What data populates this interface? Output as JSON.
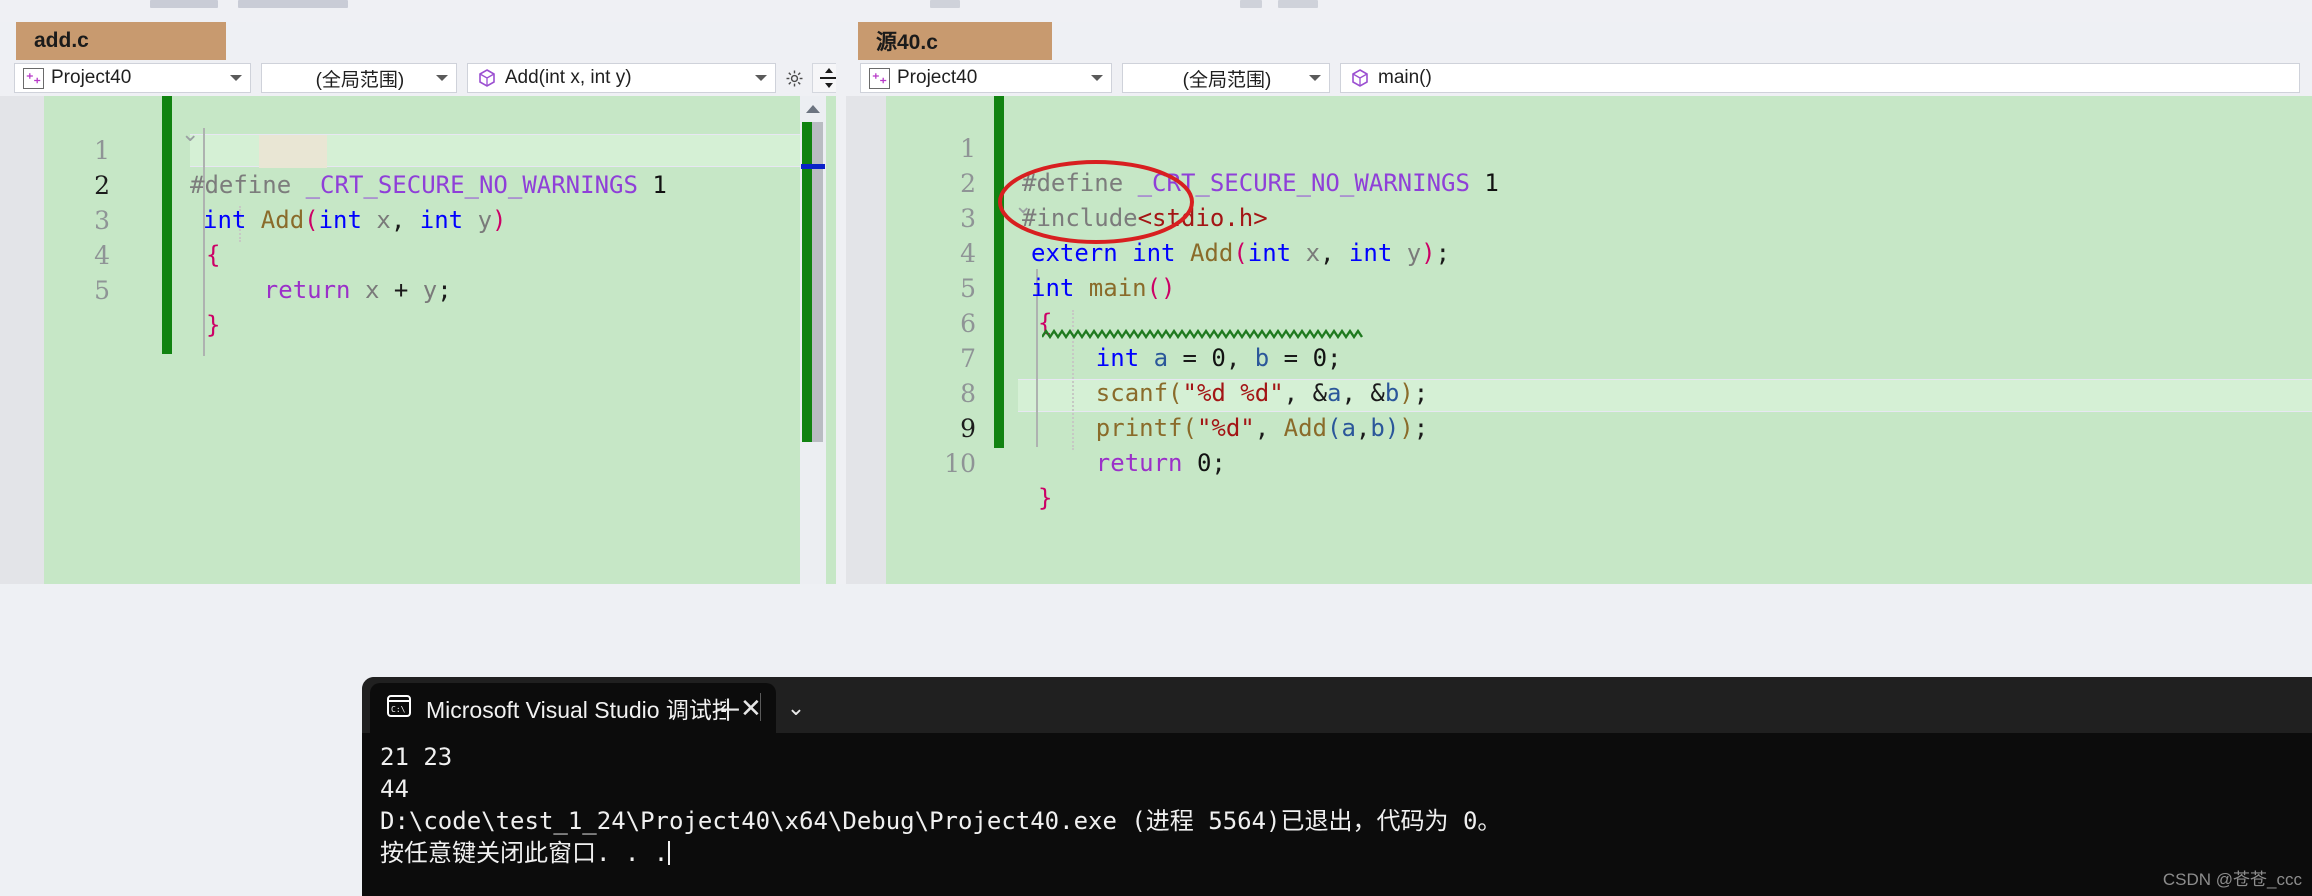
{
  "app": {
    "watermark": "CSDN @苍苍_ccc"
  },
  "tabs": [
    {
      "label": "add.c",
      "name": "tab-add-c"
    },
    {
      "label": "源40.c",
      "name": "tab-source40-c"
    }
  ],
  "left_pane": {
    "navbar": {
      "project": "Project40",
      "scope": "(全局范围)",
      "member": "Add(int x, int y)",
      "project_icon": "project-icon",
      "member_icon": "method-cube-icon",
      "gear_icon": "gear-icon",
      "caret_icon": "chevron-down-icon",
      "split_icon": "split-editor-icon"
    },
    "lines": [
      {
        "n": "1",
        "text": "#define _CRT_SECURE_NO_WARNINGS 1"
      },
      {
        "n": "2",
        "text": "int Add(int x, int y)"
      },
      {
        "n": "3",
        "text": "{"
      },
      {
        "n": "4",
        "text": "    return x + y;"
      },
      {
        "n": "5",
        "text": "}"
      }
    ]
  },
  "right_pane": {
    "navbar": {
      "project": "Project40",
      "scope": "(全局范围)",
      "member": "main()",
      "project_icon": "project-icon",
      "member_icon": "method-cube-icon"
    },
    "lines": [
      {
        "n": "1",
        "text": "#define _CRT_SECURE_NO_WARNINGS 1"
      },
      {
        "n": "2",
        "text": "#include<stdio.h>"
      },
      {
        "n": "3",
        "text": "extern int Add(int x, int y);"
      },
      {
        "n": "4",
        "text": "int main()"
      },
      {
        "n": "5",
        "text": "{"
      },
      {
        "n": "6",
        "text": "    int a = 0, b = 0;"
      },
      {
        "n": "7",
        "text": "    scanf(\"%d %d\", &a, &b);"
      },
      {
        "n": "8",
        "text": "    printf(\"%d\", Add(a,b));"
      },
      {
        "n": "9",
        "text": "    return 0;"
      },
      {
        "n": "10",
        "text": "}"
      }
    ],
    "annotation": "red-ellipse-around-extern"
  },
  "console": {
    "tab_title": "Microsoft Visual Studio 调试控",
    "tab_icon": "console-icon",
    "close_icon": "close-icon",
    "new_tab_icon": "plus-icon",
    "dropdown_icon": "chevron-down-icon",
    "output": [
      "21 23",
      "44",
      "D:\\code\\test_1_24\\Project40\\x64\\Debug\\Project40.exe (进程 5564)已退出，代码为 0。",
      "按任意键关闭此窗口. . ."
    ]
  },
  "colors": {
    "tab_active": "#c89a6f",
    "editor_bg": "#c6e7c6",
    "change_bar": "#118311",
    "annotation": "#d81f20",
    "console_bg": "#0c0c0c"
  }
}
